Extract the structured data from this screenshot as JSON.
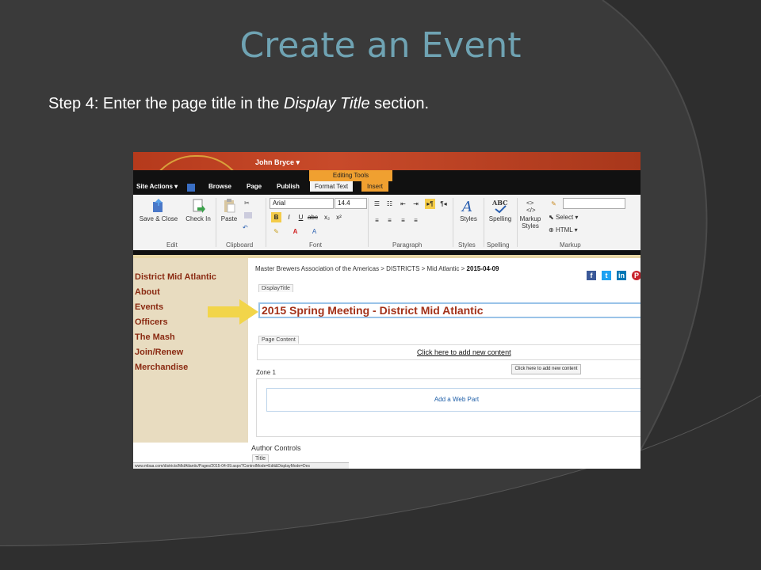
{
  "slide": {
    "title": "Create an Event",
    "subtitle_pre": "Step 4: Enter the page title in the ",
    "subtitle_em": "Display Title",
    "subtitle_post": " section."
  },
  "header": {
    "user": "John Bryce ▾",
    "editing_tools": "Editing Tools"
  },
  "nav_tabs": [
    "Site Actions ▾",
    "Browse",
    "Page",
    "Publish",
    "Format Text",
    "Insert"
  ],
  "ribbon": {
    "save_close": "Save & Close",
    "check_in": "Check In",
    "paste": "Paste",
    "font_name": "Arial",
    "font_size": "14.4",
    "styles": "Styles",
    "spelling": "Spelling",
    "markup_styles": "Markup Styles",
    "select": "Select",
    "html": "HTML",
    "groups": [
      "Edit",
      "Clipboard",
      "Font",
      "Paragraph",
      "Styles",
      "Spelling",
      "Markup"
    ]
  },
  "left_nav": [
    "District Mid Atlantic",
    "About",
    "Events",
    "Officers",
    "The Mash",
    "Join/Renew",
    "Merchandise"
  ],
  "breadcrumb": {
    "path": "Master Brewers Association of the Americas > DISTRICTS > Mid Atlantic > ",
    "current": "2015-04-09"
  },
  "display_title": {
    "label": "DisplayTitle",
    "value": "2015 Spring Meeting - District Mid Atlantic"
  },
  "page_content": {
    "label": "Page Content",
    "link": "Click here to add new content"
  },
  "zone": {
    "button": "Click here to add new content",
    "label": "Zone 1",
    "add_web_part": "Add a Web Part"
  },
  "author_controls": {
    "label": "Author Controls",
    "title_tab": "Title"
  },
  "status_url": "www.mbaa.com/districts/MidAtlantic/Pages/2015-04-09.aspx?ControlMode=Edit&DisplayMode=Des",
  "colors": {
    "title": "#6fa3b3",
    "arrow": "#f2d54a",
    "nav_text": "#8a2a12"
  }
}
